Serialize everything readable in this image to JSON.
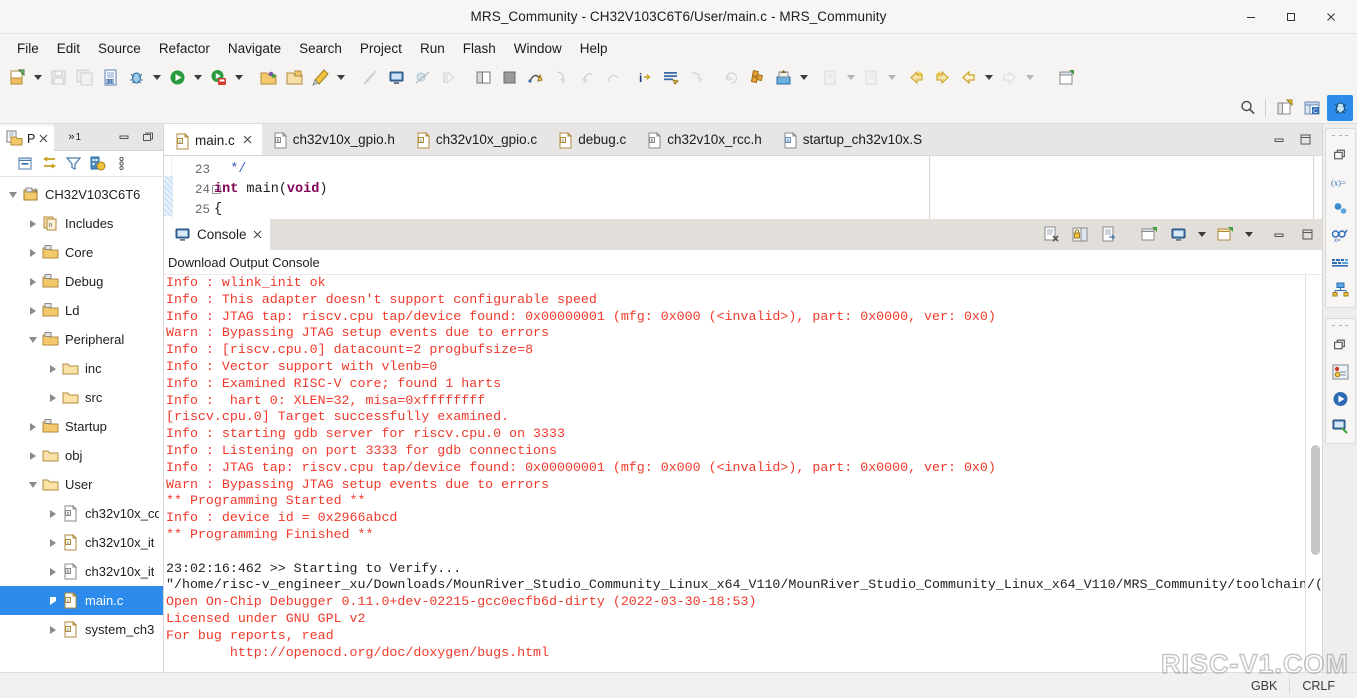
{
  "window": {
    "title": "MRS_Community - CH32V103C6T6/User/main.c - MRS_Community",
    "minimize_label": "Minimize",
    "maximize_label": "Maximize",
    "close_label": "Close"
  },
  "menubar": {
    "items": [
      "File",
      "Edit",
      "Source",
      "Refactor",
      "Navigate",
      "Search",
      "Project",
      "Run",
      "Flash",
      "Window",
      "Help"
    ]
  },
  "toolbar": {
    "items": [
      {
        "name": "new-file-button",
        "icon": "new-file-icon"
      },
      {
        "name": "new-file-dropdown",
        "icon": "caret-down-icon"
      },
      {
        "name": "save-button",
        "icon": "save-icon"
      },
      {
        "name": "save-all-button",
        "icon": "save-all-icon"
      },
      {
        "name": "new-source-file-button",
        "icon": "binary-file-icon"
      },
      {
        "name": "debug-button",
        "icon": "bug-icon"
      },
      {
        "name": "debug-dropdown",
        "icon": "caret-down-icon"
      },
      {
        "name": "run-button",
        "icon": "run-icon"
      },
      {
        "name": "run-dropdown",
        "icon": "caret-down-icon"
      },
      {
        "name": "download-button",
        "icon": "download-icon"
      },
      {
        "name": "download-dropdown",
        "icon": "caret-down-icon"
      },
      {
        "name": "open-project-button",
        "icon": "open-project-icon"
      },
      {
        "name": "close-project-button",
        "icon": "close-project-icon"
      },
      {
        "name": "build-button",
        "icon": "hammer-icon"
      },
      {
        "name": "build-dropdown",
        "icon": "caret-down-icon"
      },
      {
        "name": "clean-button",
        "icon": "clean-icon"
      },
      {
        "name": "terminal-button",
        "icon": "terminal-icon"
      },
      {
        "name": "skip-breakpoints-button",
        "icon": "skip-breakpoints-icon"
      },
      {
        "name": "resume-button",
        "icon": "resume-icon"
      },
      {
        "name": "toggle-split-button",
        "icon": "split-editor-icon"
      },
      {
        "name": "stop-button",
        "icon": "stop-icon"
      },
      {
        "name": "step-over-button",
        "icon": "step-over-icon"
      },
      {
        "name": "step-into-button",
        "icon": "step-into-icon"
      },
      {
        "name": "step-return-button",
        "icon": "step-return-icon"
      },
      {
        "name": "instruction-stepping-button",
        "icon": "instruction-step-icon"
      },
      {
        "name": "info-button",
        "icon": "info-arrow-icon"
      },
      {
        "name": "open-declaration-button",
        "icon": "lines-icon"
      },
      {
        "name": "last-edit-button",
        "icon": "last-edit-icon"
      },
      {
        "name": "refresh-button",
        "icon": "refresh-icon"
      },
      {
        "name": "search-task-button",
        "icon": "blocks-icon"
      },
      {
        "name": "open-type-button",
        "icon": "open-type-icon"
      },
      {
        "name": "open-type-dropdown",
        "icon": "caret-down-icon"
      },
      {
        "name": "next-annotation-button",
        "icon": "next-annotation-icon"
      },
      {
        "name": "next-annotation-dropdown",
        "icon": "caret-down-icon"
      },
      {
        "name": "previous-annotation-button",
        "icon": "previous-annotation-icon"
      },
      {
        "name": "previous-annotation-dropdown",
        "icon": "caret-down-icon"
      },
      {
        "name": "back-button",
        "icon": "back-arrow-icon"
      },
      {
        "name": "forward-button",
        "icon": "forward-arrow-icon"
      },
      {
        "name": "back-history-dropdown",
        "icon": "caret-down-icon"
      },
      {
        "name": "forward-history-dropdown",
        "icon": "caret-down-icon"
      },
      {
        "name": "new-window-button",
        "icon": "new-window-icon"
      }
    ],
    "row2": [
      {
        "name": "quick-access-search",
        "icon": "search-icon"
      },
      {
        "name": "open-perspective-button",
        "icon": "open-perspective-icon"
      },
      {
        "name": "c-cpp-perspective-button",
        "icon": "c-cpp-perspective-icon"
      },
      {
        "name": "debug-perspective-button",
        "icon": "debug-perspective-icon"
      }
    ]
  },
  "project_explorer": {
    "tab_label": "P",
    "tab_overflow_label": "»",
    "tab_overflow_count": "1",
    "toolbar": [
      {
        "name": "collapse-all-button",
        "icon": "collapse-all-icon"
      },
      {
        "name": "link-with-editor-button",
        "icon": "link-editor-icon"
      },
      {
        "name": "filters-button",
        "icon": "filter-icon"
      },
      {
        "name": "build-config-button",
        "icon": "build-config-icon"
      },
      {
        "name": "view-menu-button",
        "icon": "view-menu-icon"
      }
    ],
    "tree": [
      {
        "label": "CH32V103C6T6",
        "indent": 0,
        "expanded": true,
        "icon": "c-project-icon",
        "selected": false
      },
      {
        "label": "Includes",
        "indent": 1,
        "expanded": false,
        "icon": "includes-icon",
        "selected": false
      },
      {
        "label": "Core",
        "indent": 1,
        "expanded": false,
        "icon": "source-folder-icon",
        "selected": false
      },
      {
        "label": "Debug",
        "indent": 1,
        "expanded": false,
        "icon": "source-folder-icon",
        "selected": false
      },
      {
        "label": "Ld",
        "indent": 1,
        "expanded": false,
        "icon": "source-folder-icon",
        "selected": false
      },
      {
        "label": "Peripheral",
        "indent": 1,
        "expanded": true,
        "icon": "source-folder-icon",
        "selected": false
      },
      {
        "label": "inc",
        "indent": 2,
        "expanded": false,
        "icon": "folder-icon",
        "selected": false
      },
      {
        "label": "src",
        "indent": 2,
        "expanded": false,
        "icon": "folder-icon",
        "selected": false
      },
      {
        "label": "Startup",
        "indent": 1,
        "expanded": false,
        "icon": "source-folder-icon",
        "selected": false
      },
      {
        "label": "obj",
        "indent": 1,
        "expanded": false,
        "icon": "folder-icon",
        "selected": false
      },
      {
        "label": "User",
        "indent": 1,
        "expanded": true,
        "icon": "folder-icon",
        "selected": false
      },
      {
        "label": "ch32v10x_co",
        "indent": 2,
        "expanded": false,
        "icon": "h-file-icon",
        "selected": false
      },
      {
        "label": "ch32v10x_it",
        "indent": 2,
        "expanded": false,
        "icon": "c-file-icon",
        "selected": false
      },
      {
        "label": "ch32v10x_it",
        "indent": 2,
        "expanded": false,
        "icon": "h-file-icon",
        "selected": false
      },
      {
        "label": "main.c",
        "indent": 2,
        "expanded": false,
        "icon": "c-file-icon",
        "selected": true
      },
      {
        "label": "system_ch3",
        "indent": 2,
        "expanded": false,
        "icon": "c-file-icon",
        "selected": false
      }
    ]
  },
  "editor": {
    "tabs": [
      {
        "label": "main.c",
        "icon": "c-file-icon",
        "selected": true,
        "closable": true
      },
      {
        "label": "ch32v10x_gpio.h",
        "icon": "h-file-icon",
        "selected": false,
        "closable": false
      },
      {
        "label": "ch32v10x_gpio.c",
        "icon": "c-file-icon",
        "selected": false,
        "closable": false
      },
      {
        "label": "debug.c",
        "icon": "c-file-icon",
        "selected": false,
        "closable": false
      },
      {
        "label": "ch32v10x_rcc.h",
        "icon": "h-file-icon",
        "selected": false,
        "closable": false
      },
      {
        "label": "startup_ch32v10x.S",
        "icon": "s-file-icon",
        "selected": false,
        "closable": false
      }
    ],
    "minimize_label": "Minimize",
    "maximize_label": "Maximize",
    "lines": [
      {
        "number": "23",
        "fold": false,
        "segments": [
          {
            "t": "  ",
            "c": "plain"
          },
          {
            "t": "*/",
            "c": "comment"
          }
        ]
      },
      {
        "number": "24",
        "fold": true,
        "segments": [
          {
            "t": "int ",
            "c": "keyword"
          },
          {
            "t": "main",
            "c": "plain"
          },
          {
            "t": "(",
            "c": "plain"
          },
          {
            "t": "void",
            "c": "keyword"
          },
          {
            "t": ")",
            "c": "plain"
          }
        ]
      },
      {
        "number": "25",
        "fold": false,
        "segments": [
          {
            "t": "{",
            "c": "plain"
          }
        ]
      }
    ]
  },
  "console": {
    "tab_label": "Console",
    "title": "Download Output Console",
    "toolbar": [
      {
        "name": "clear-console-button",
        "icon": "clear-console-icon"
      },
      {
        "name": "scroll-lock-button",
        "icon": "scroll-lock-icon"
      },
      {
        "name": "word-wrap-button",
        "icon": "word-wrap-icon"
      },
      {
        "name": "pin-console-button",
        "icon": "pin-console-icon"
      },
      {
        "name": "display-selected-console-button",
        "icon": "display-console-icon"
      },
      {
        "name": "display-selected-console-dropdown",
        "icon": "caret-down-icon"
      },
      {
        "name": "open-console-button",
        "icon": "open-console-icon"
      },
      {
        "name": "open-console-dropdown",
        "icon": "caret-down-icon"
      },
      {
        "name": "minimize-console-button",
        "icon": "minimize-icon"
      },
      {
        "name": "maximize-console-button",
        "icon": "maximize-icon"
      }
    ],
    "lines": [
      {
        "text": "Info : wlink_init ok",
        "color": "red"
      },
      {
        "text": "Info : This adapter doesn't support configurable speed",
        "color": "red"
      },
      {
        "text": "Info : JTAG tap: riscv.cpu tap/device found: 0x00000001 (mfg: 0x000 (<invalid>), part: 0x0000, ver: 0x0)",
        "color": "red"
      },
      {
        "text": "Warn : Bypassing JTAG setup events due to errors",
        "color": "red"
      },
      {
        "text": "Info : [riscv.cpu.0] datacount=2 progbufsize=8",
        "color": "red"
      },
      {
        "text": "Info : Vector support with vlenb=0",
        "color": "red"
      },
      {
        "text": "Info : Examined RISC-V core; found 1 harts",
        "color": "red"
      },
      {
        "text": "Info :  hart 0: XLEN=32, misa=0xffffffff",
        "color": "red"
      },
      {
        "text": "[riscv.cpu.0] Target successfully examined.",
        "color": "red"
      },
      {
        "text": "Info : starting gdb server for riscv.cpu.0 on 3333",
        "color": "red"
      },
      {
        "text": "Info : Listening on port 3333 for gdb connections",
        "color": "red"
      },
      {
        "text": "Info : JTAG tap: riscv.cpu tap/device found: 0x00000001 (mfg: 0x000 (<invalid>), part: 0x0000, ver: 0x0)",
        "color": "red"
      },
      {
        "text": "Warn : Bypassing JTAG setup events due to errors",
        "color": "red"
      },
      {
        "text": "** Programming Started **",
        "color": "red"
      },
      {
        "text": "Info : device id = 0x2966abcd",
        "color": "red"
      },
      {
        "text": "** Programming Finished **",
        "color": "red"
      },
      {
        "text": "",
        "color": "red"
      },
      {
        "text": "23:02:16:462 >> Starting to Verify...",
        "color": "dark"
      },
      {
        "text": "\"/home/risc-v_engineer_xu/Downloads/MounRiver_Studio_Community_Linux_x64_V110/MounRiver_Studio_Community_Linux_x64_V110/MRS_Community/toolchain/(",
        "color": "dark"
      },
      {
        "text": "Open On-Chip Debugger 0.11.0+dev-02215-gcc0ecfb6d-dirty (2022-03-30-18:53)",
        "color": "red"
      },
      {
        "text": "Licensed under GNU GPL v2",
        "color": "red"
      },
      {
        "text": "For bug reports, read",
        "color": "red"
      },
      {
        "text": "        http://openocd.org/doc/doxygen/bugs.html",
        "color": "red"
      }
    ]
  },
  "rail": {
    "groups": [
      {
        "name": "editor-rail-group",
        "buttons": [
          {
            "name": "restore-icon",
            "label": "Restore"
          },
          {
            "name": "variables-view-icon",
            "label": "(x)="
          },
          {
            "name": "breakpoints-view-icon",
            "label": "Breakpoints"
          },
          {
            "name": "expressions-view-icon",
            "label": "Expressions"
          },
          {
            "name": "registers-view-icon",
            "label": "Registers"
          },
          {
            "name": "peripherals-view-icon",
            "label": "Peripherals"
          }
        ]
      },
      {
        "name": "debug-rail-group",
        "buttons": [
          {
            "name": "restore-icon",
            "label": "Restore"
          },
          {
            "name": "debug-view-icon",
            "label": "Debug"
          },
          {
            "name": "run-view-icon",
            "label": "Run"
          },
          {
            "name": "console-view-icon",
            "label": "Console"
          }
        ]
      }
    ]
  },
  "statusbar": {
    "encoding": "GBK",
    "line_delimiter": "CRLF",
    "watermark": "RISC-V1.COM"
  }
}
